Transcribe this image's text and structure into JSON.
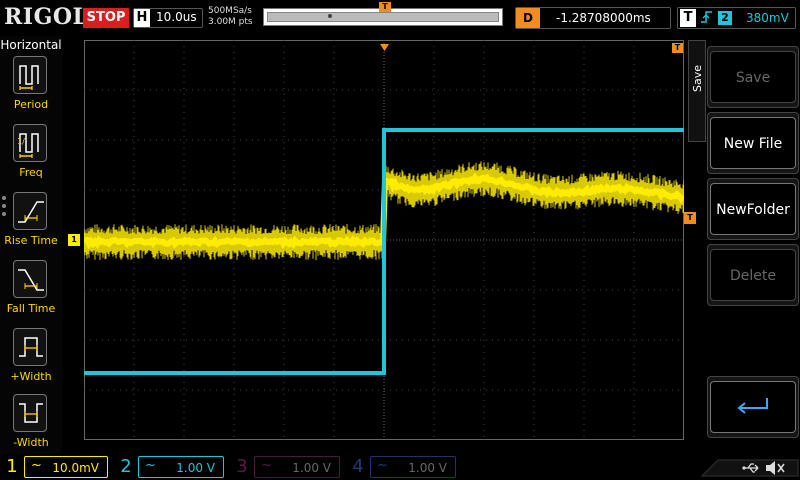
{
  "header": {
    "brand": "RIGOL",
    "run_state": "STOP",
    "horizontal_label": "H",
    "timebase": "10.0us",
    "sample_rate": "500MSa/s",
    "memory_depth": "3.00M pts",
    "trigger_pos_label": "T",
    "delay_label": "D",
    "delay_value": "-1.28708000ms",
    "trigger_label": "T",
    "trigger_edge": "rising-edge-icon",
    "trigger_source": "2",
    "trigger_level": "380mV"
  },
  "left_menu": {
    "title": "Horizontal",
    "items": [
      {
        "label": "Period",
        "icon": "period-icon"
      },
      {
        "label": "Freq",
        "icon": "frequency-icon"
      },
      {
        "label": "Rise Time",
        "icon": "rise-time-icon"
      },
      {
        "label": "Fall Time",
        "icon": "fall-time-icon"
      },
      {
        "label": "+Width",
        "icon": "positive-width-icon"
      },
      {
        "label": "-Width",
        "icon": "negative-width-icon"
      }
    ]
  },
  "right_menu": {
    "tab_label": "Save",
    "buttons": [
      {
        "label": "Save",
        "enabled": false
      },
      {
        "label": "New File",
        "enabled": true
      },
      {
        "label": "NewFolder",
        "enabled": true
      },
      {
        "label": "Delete",
        "enabled": false
      },
      {
        "label": "",
        "icon": "return-icon",
        "enabled": true
      }
    ]
  },
  "channels": [
    {
      "number": "1",
      "coupling": "~",
      "scale": "10.0mV",
      "color": "#ffec00",
      "active": true
    },
    {
      "number": "2",
      "coupling": "~",
      "scale": "1.00 V",
      "color": "#22c4d8",
      "active": true
    },
    {
      "number": "3",
      "coupling": "~",
      "scale": "1.00 V",
      "color": "#c0208f",
      "active": false
    },
    {
      "number": "4",
      "coupling": "~",
      "scale": "1.00 V",
      "color": "#2058c8",
      "active": false
    }
  ],
  "markers": {
    "ch1": "1",
    "trigger_level_flag": "T",
    "trigger_level_arrow": "T"
  },
  "status_icons": [
    "usb-icon",
    "mute-speaker-icon"
  ],
  "colors": {
    "ch1": "#ffec00",
    "ch2": "#22c4d8",
    "trigger": "#f28c1e",
    "stop": "#d81e1e",
    "grid": "#555555"
  }
}
